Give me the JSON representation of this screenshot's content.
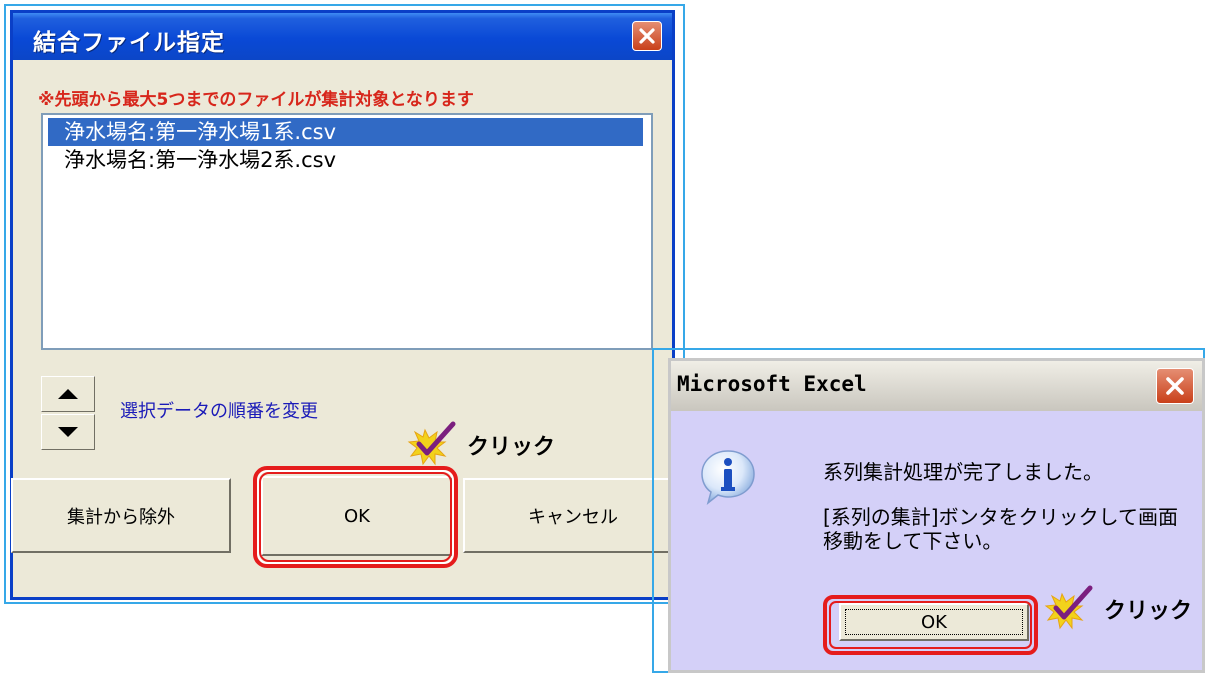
{
  "dialog_merge": {
    "title": "結合ファイル指定",
    "note": "※先頭から最大5つまでのファイルが集計対象となります",
    "files": [
      "浄水場名:第一浄水場1系.csv",
      "浄水場名:第一浄水場2系.csv"
    ],
    "selected_index": 0,
    "order_label": "選択データの順番を変更",
    "buttons": {
      "exclude": "集計から除外",
      "ok": "OK",
      "cancel": "キャンセル"
    }
  },
  "dialog_excel": {
    "title": "Microsoft Excel",
    "message_line1": "系列集計処理が完了しました。",
    "message_line2": "[系列の集計]ボンタをクリックして画面移動をして下さい。",
    "ok": "OK"
  },
  "annotations": {
    "click_1": "クリック",
    "click_2": "クリック"
  },
  "colors": {
    "highlight": "#e51c1c",
    "xp_titlebar": "#0a49d6",
    "note_red": "#d7261b",
    "selection": "#316ac5"
  }
}
